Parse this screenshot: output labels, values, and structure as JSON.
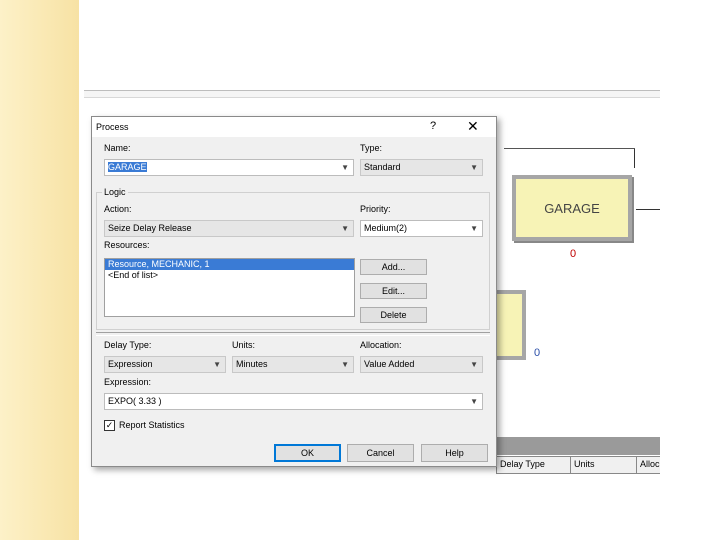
{
  "arena": {
    "module_label": "GARAGE",
    "module_count": "0",
    "other_count": "0",
    "grid_headers": [
      "Delay Type",
      "Units",
      "Alloc"
    ]
  },
  "dialog": {
    "title": "Process",
    "help_symbol": "?",
    "close_symbol": "✕",
    "name_label": "Name:",
    "name_value": "GARAGE",
    "type_label": "Type:",
    "type_value": "Standard",
    "logic_label": "Logic",
    "action_label": "Action:",
    "action_value": "Seize Delay Release",
    "priority_label": "Priority:",
    "priority_value": "Medium(2)",
    "resources_label": "Resources:",
    "resources_items": [
      "Resource, MECHANIC, 1",
      "<End of list>"
    ],
    "add_label": "Add...",
    "edit_label": "Edit...",
    "delete_label": "Delete",
    "delay_type_label": "Delay Type:",
    "delay_type_value": "Expression",
    "units_label": "Units:",
    "units_value": "Minutes",
    "allocation_label": "Allocation:",
    "allocation_value": "Value Added",
    "expression_label": "Expression:",
    "expression_value": "EXPO( 3.33 )",
    "report_stats_label": "Report Statistics",
    "report_stats_checked": "✓",
    "ok_label": "OK",
    "cancel_label": "Cancel",
    "help_label": "Help"
  },
  "colors": {
    "slide_bar": "#f7e2a4",
    "module_fill": "#f7f3b6",
    "selection": "#3a7bd5",
    "count_red": "#c00000",
    "count_blue": "#2a4ea8"
  }
}
